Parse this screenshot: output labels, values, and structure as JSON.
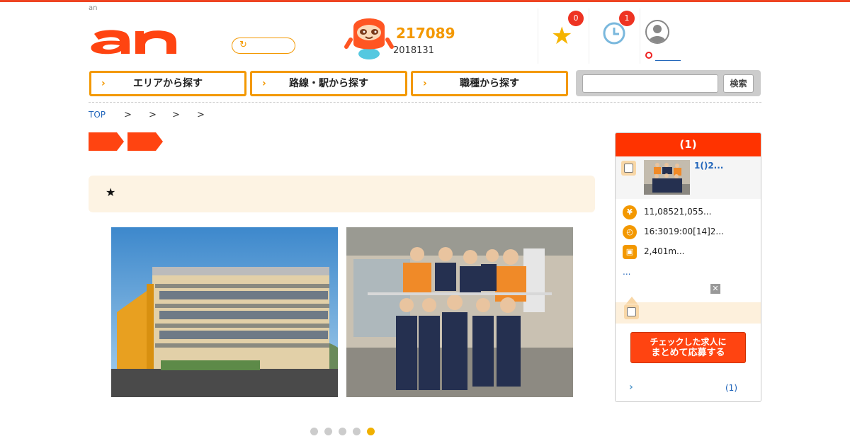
{
  "header": {
    "site_small": "an",
    "logo_text": "an",
    "stats": {
      "primary": "217089",
      "secondary": "2018131"
    },
    "favorites_count": "0",
    "history_count": "1"
  },
  "search_nav": {
    "area_label": "エリアから探す",
    "route_label": "路線・駅から探す",
    "occupation_label": "職種から探す",
    "keyword_placeholder": "",
    "submit_label": "検索"
  },
  "breadcrumb": {
    "top_label": "TOP",
    "separators": [
      ">",
      ">",
      ">",
      ">"
    ]
  },
  "notice": {
    "star": "★"
  },
  "carousel": {
    "total": 5,
    "active_index": 4
  },
  "sidebar": {
    "header": "(1)",
    "job_title": "1()2...",
    "salary": "11,08521,055...",
    "hours": "16:3019:00[14]2...",
    "access": "2,401m...",
    "more": "...",
    "apply_line1": "チェックした求人に",
    "apply_line2": "まとめて応募する",
    "list_link": "(1)"
  },
  "colors": {
    "accent": "#f39800",
    "brand": "#ff4411",
    "link": "#2266bb"
  },
  "icons": [
    "reload-icon",
    "star-icon",
    "clock-icon",
    "user-icon",
    "yen-icon",
    "time-icon",
    "train-icon",
    "close-icon",
    "chevron-right-icon"
  ]
}
